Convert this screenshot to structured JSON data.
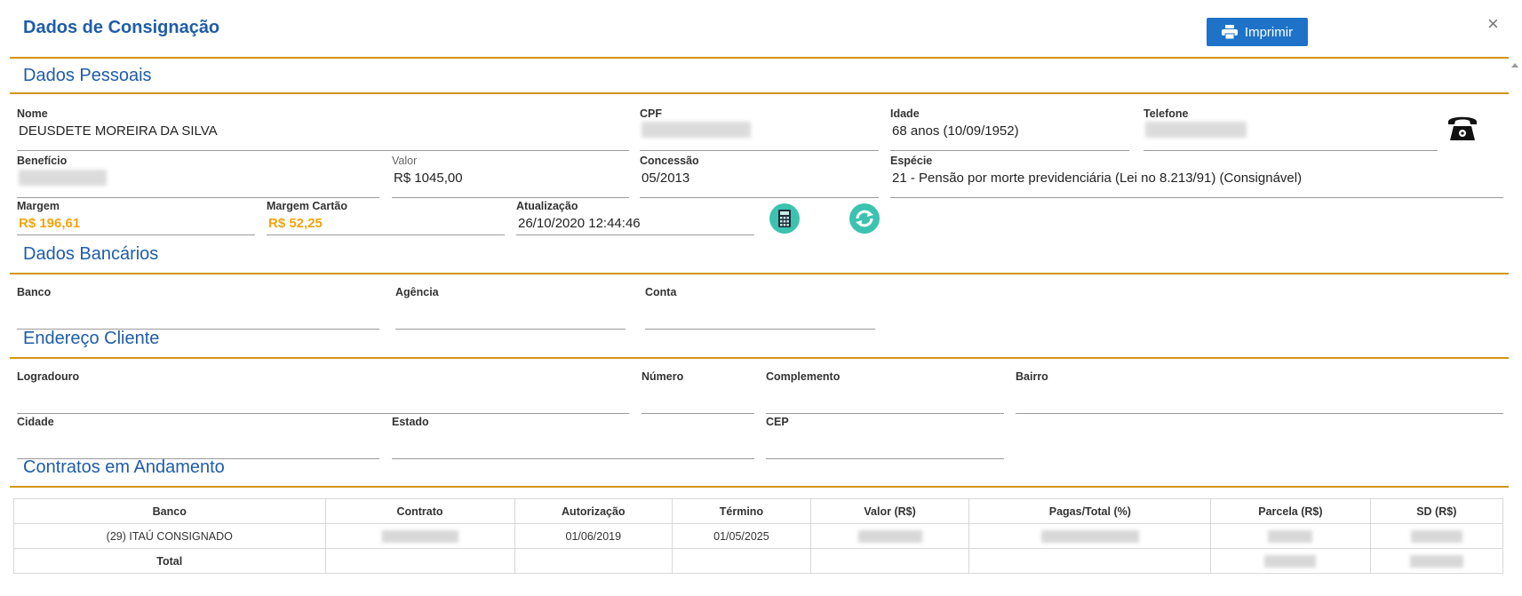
{
  "dialog": {
    "title": "Dados de Consignação",
    "print_label": "Imprimir",
    "close_label": "×"
  },
  "sections": {
    "personal": "Dados Pessoais",
    "bank": "Dados Bancários",
    "address": "Endereço Cliente",
    "contracts": "Contratos em Andamento"
  },
  "personal": {
    "nome_label": "Nome",
    "nome": "DEUSDETE MOREIRA DA SILVA",
    "cpf_label": "CPF",
    "idade_label": "Idade",
    "idade": "68 anos (10/09/1952)",
    "telefone_label": "Telefone",
    "beneficio_label": "Benefício",
    "valor_label": "Valor",
    "valor": "R$ 1045,00",
    "concessao_label": "Concessão",
    "concessao": "05/2013",
    "especie_label": "Espécie",
    "especie": "21 - Pensão por morte previdenciária (Lei no 8.213/91) (Consignável)",
    "margem_label": "Margem",
    "margem": "R$ 196,61",
    "margem_cartao_label": "Margem Cartão",
    "margem_cartao": "R$ 52,25",
    "atualizacao_label": "Atualização",
    "atualizacao": "26/10/2020 12:44:46"
  },
  "bank": {
    "banco_label": "Banco",
    "agencia_label": "Agência",
    "conta_label": "Conta"
  },
  "address": {
    "logradouro_label": "Logradouro",
    "numero_label": "Número",
    "complemento_label": "Complemento",
    "bairro_label": "Bairro",
    "cidade_label": "Cidade",
    "estado_label": "Estado",
    "cep_label": "CEP"
  },
  "contracts": {
    "headers": [
      "Banco",
      "Contrato",
      "Autorização",
      "Término",
      "Valor (R$)",
      "Pagas/Total (%)",
      "Parcela (R$)",
      "SD (R$)"
    ],
    "rows": [
      {
        "banco": "(29) ITAÚ CONSIGNADO",
        "autorizacao": "01/06/2019",
        "termino": "01/05/2025"
      }
    ],
    "total_label": "Total"
  },
  "colors": {
    "accent": "#1f5ca8",
    "rule": "#d3950f",
    "highlight": "#f4a40e",
    "button": "#1e73c9",
    "action_icon": "#3cc3b0"
  },
  "icons": [
    "printer-icon",
    "close-icon",
    "telephone-icon",
    "calculator-icon",
    "refresh-icon"
  ]
}
